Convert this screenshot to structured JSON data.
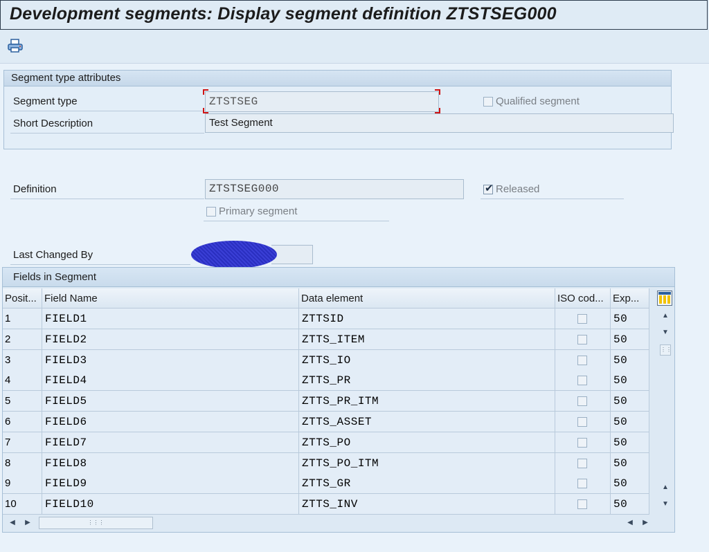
{
  "window": {
    "title": "Development segments: Display segment definition ZTSTSEG000"
  },
  "toolbar": {
    "print_icon": "printer-icon"
  },
  "attributes_group": {
    "title": "Segment type attributes",
    "segment_type_label": "Segment type",
    "segment_type_value": "ZTSTSEG",
    "qualified_label": "Qualified segment",
    "qualified_checked": false,
    "short_desc_label": "Short Description",
    "short_desc_value": "Test Segment"
  },
  "definition": {
    "label": "Definition",
    "value": "ZTSTSEG000",
    "released_label": "Released",
    "released_checked": true,
    "primary_label": "Primary segment",
    "primary_checked": false
  },
  "last_changed": {
    "label": "Last Changed By"
  },
  "fields_table": {
    "title": "Fields in Segment",
    "columns": [
      "Posit...",
      "Field Name",
      "Data element",
      "ISO cod...",
      "Exp..."
    ],
    "rows": [
      {
        "pos": "1",
        "field": "FIELD1",
        "element": "ZTTSID",
        "iso": false,
        "exp": "50"
      },
      {
        "pos": "2",
        "field": "FIELD2",
        "element": "ZTTS_ITEM",
        "iso": false,
        "exp": "50"
      },
      {
        "pos": "3",
        "field": "FIELD3",
        "element": "ZTTS_IO",
        "iso": false,
        "exp": "50"
      },
      {
        "pos": "4",
        "field": "FIELD4",
        "element": "ZTTS_PR",
        "iso": false,
        "exp": "50"
      },
      {
        "pos": "5",
        "field": "FIELD5",
        "element": "ZTTS_PR_ITM",
        "iso": false,
        "exp": "50"
      },
      {
        "pos": "6",
        "field": "FIELD6",
        "element": "ZTTS_ASSET",
        "iso": false,
        "exp": "50"
      },
      {
        "pos": "7",
        "field": "FIELD7",
        "element": "ZTTS_PO",
        "iso": false,
        "exp": "50"
      },
      {
        "pos": "8",
        "field": "FIELD8",
        "element": "ZTTS_PO_ITM",
        "iso": false,
        "exp": "50"
      },
      {
        "pos": "9",
        "field": "FIELD9",
        "element": "ZTTS_GR",
        "iso": false,
        "exp": "50"
      },
      {
        "pos": "10",
        "field": "FIELD10",
        "element": "ZTTS_INV",
        "iso": false,
        "exp": "50"
      }
    ]
  },
  "colors": {
    "background": "#dfebf5",
    "accent": "#1e2f45",
    "focus": "#d01414"
  }
}
